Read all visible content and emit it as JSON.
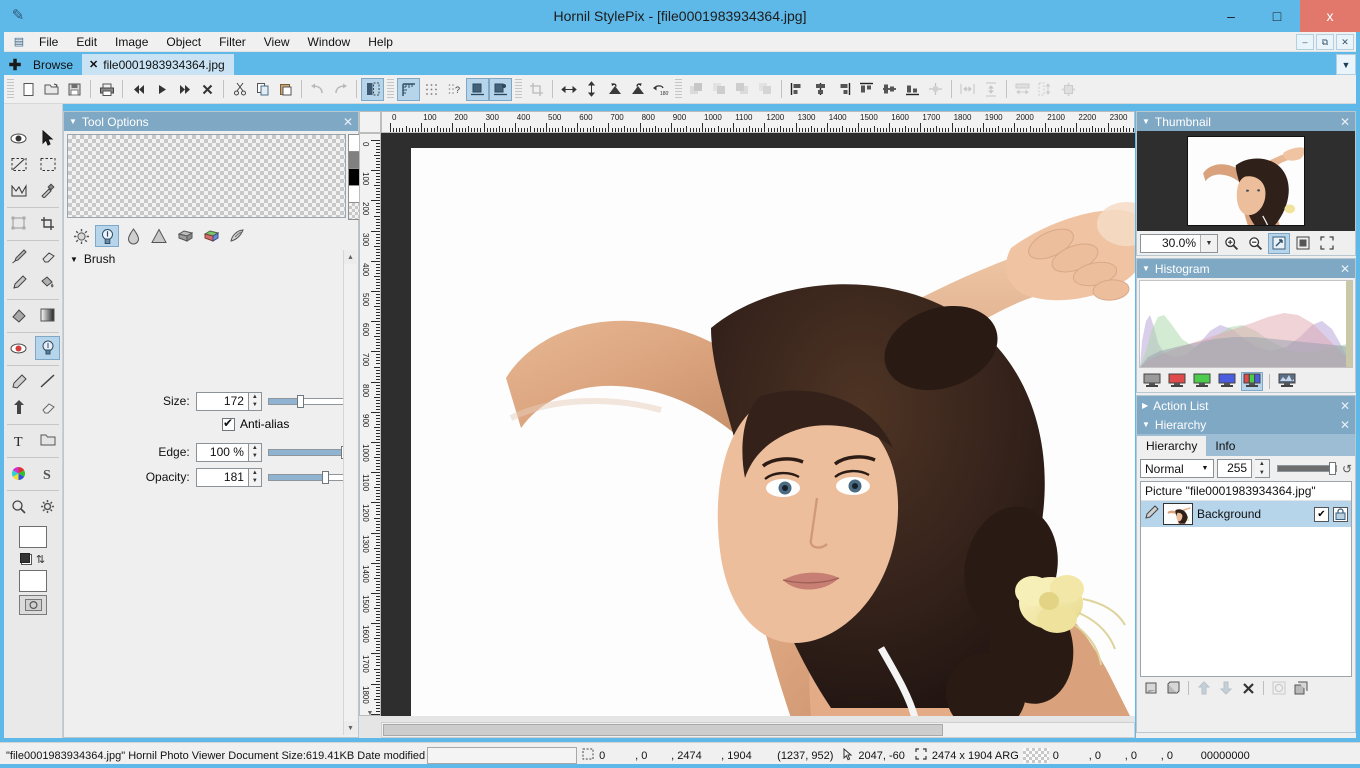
{
  "window": {
    "title": "Hornil StylePix - [file0001983934364.jpg]",
    "app_icon": "pencil-icon",
    "minimize": "–",
    "maximize": "□",
    "close": "x"
  },
  "menubar": {
    "logo": "stylepix-logo-icon",
    "items": [
      "File",
      "Edit",
      "Image",
      "Object",
      "Filter",
      "View",
      "Window",
      "Help"
    ],
    "mdi_buttons": [
      "–",
      "⧉",
      "✕"
    ]
  },
  "tabbar": {
    "add_label": "✚",
    "tabs": [
      {
        "label": "Browse",
        "closable": false,
        "active": false
      },
      {
        "label": "file0001983934364.jpg",
        "closable": true,
        "close_glyph": "✕",
        "active": true
      }
    ],
    "overflow_glyph": "▼"
  },
  "toolbar": {
    "groups": [
      {
        "buttons": [
          {
            "name": "new-document-button",
            "glyph": "▯",
            "state": "normal"
          },
          {
            "name": "open-file-button",
            "glyph": "📂",
            "state": "normal"
          },
          {
            "name": "save-file-button",
            "glyph": "💾",
            "state": "normal"
          }
        ]
      },
      {
        "buttons": [
          {
            "name": "print-button",
            "glyph": "🖨",
            "state": "normal"
          }
        ]
      },
      {
        "buttons": [
          {
            "name": "previous-frame-button",
            "glyph": "◀◀",
            "state": "normal"
          },
          {
            "name": "play-button",
            "glyph": "▶",
            "state": "normal"
          },
          {
            "name": "next-frame-button",
            "glyph": "▶▶",
            "state": "normal"
          },
          {
            "name": "stop-button",
            "glyph": "✕",
            "state": "normal"
          }
        ]
      },
      {
        "buttons": [
          {
            "name": "cut-button",
            "glyph": "✂",
            "state": "normal"
          },
          {
            "name": "copy-button",
            "glyph": "⧉",
            "state": "normal"
          },
          {
            "name": "paste-button",
            "glyph": "📋",
            "state": "normal"
          }
        ]
      },
      {
        "buttons": [
          {
            "name": "undo-button",
            "glyph": "↩",
            "state": "disabled"
          },
          {
            "name": "redo-button",
            "glyph": "↪",
            "state": "disabled"
          }
        ]
      },
      {
        "buttons": [
          {
            "name": "toggle-panel-button",
            "glyph": "▮",
            "state": "active"
          }
        ]
      },
      {
        "buttons": [
          {
            "name": "show-rulers-button",
            "glyph": "ruler-icon",
            "state": "active"
          },
          {
            "name": "show-grid-button",
            "glyph": "grid-icon",
            "state": "normal"
          },
          {
            "name": "show-guides-button",
            "glyph": "guides-icon",
            "state": "normal"
          },
          {
            "name": "snap-to-canvas-button",
            "glyph": "snap-canvas-icon",
            "state": "active"
          },
          {
            "name": "snap-to-guides-button",
            "glyph": "snap-guides-icon",
            "state": "active"
          }
        ]
      },
      {
        "buttons": [
          {
            "name": "crop-button",
            "glyph": "crop-icon",
            "state": "disabled"
          }
        ]
      },
      {
        "buttons": [
          {
            "name": "flip-horizontal-button",
            "glyph": "↔",
            "state": "normal"
          },
          {
            "name": "flip-vertical-button",
            "glyph": "↕",
            "state": "normal"
          },
          {
            "name": "rotate-left-button",
            "glyph": "rotate-ccw-icon",
            "state": "normal"
          },
          {
            "name": "rotate-right-button",
            "glyph": "rotate-cw-icon",
            "state": "normal"
          },
          {
            "name": "rotate-180-button",
            "glyph": "rotate-180-icon",
            "state": "normal"
          }
        ]
      },
      {
        "buttons": [
          {
            "name": "arrange-bring-front-button",
            "glyph": "▰",
            "state": "disabled"
          },
          {
            "name": "arrange-bring-forward-button",
            "glyph": "▱",
            "state": "disabled"
          },
          {
            "name": "arrange-send-backward-button",
            "glyph": "▰",
            "state": "disabled"
          },
          {
            "name": "arrange-send-back-button",
            "glyph": "▱",
            "state": "disabled"
          }
        ]
      },
      {
        "buttons": [
          {
            "name": "align-left-button",
            "glyph": "align-left-icon",
            "state": "normal"
          },
          {
            "name": "align-center-horizontal-button",
            "glyph": "align-center-h-icon",
            "state": "normal"
          },
          {
            "name": "align-right-button",
            "glyph": "align-right-icon",
            "state": "normal"
          },
          {
            "name": "align-top-button",
            "glyph": "align-top-icon",
            "state": "normal"
          },
          {
            "name": "align-middle-button",
            "glyph": "align-middle-icon",
            "state": "normal"
          },
          {
            "name": "align-bottom-button",
            "glyph": "align-bottom-icon",
            "state": "normal"
          },
          {
            "name": "align-center-button",
            "glyph": "align-center-icon",
            "state": "disabled"
          }
        ]
      },
      {
        "buttons": [
          {
            "name": "distribute-horizontal-button",
            "glyph": "dist-h-icon",
            "state": "disabled"
          },
          {
            "name": "distribute-vertical-button",
            "glyph": "dist-v-icon",
            "state": "disabled"
          }
        ]
      },
      {
        "buttons": [
          {
            "name": "match-width-button",
            "glyph": "match-w-icon",
            "state": "disabled"
          },
          {
            "name": "match-height-button",
            "glyph": "match-h-icon",
            "state": "disabled"
          },
          {
            "name": "match-size-button",
            "glyph": "match-size-icon",
            "state": "disabled"
          }
        ]
      }
    ]
  },
  "tool_palette": {
    "tools": [
      {
        "name": "visibility-tool",
        "glyph": "👁",
        "active": false
      },
      {
        "name": "move-tool",
        "glyph": "➤",
        "active": false
      },
      {
        "name": "lasso-select-tool",
        "glyph": "lasso-icon",
        "active": false
      },
      {
        "name": "rectangle-select-tool",
        "glyph": "marquee-icon",
        "active": false
      },
      {
        "name": "polygon-select-tool",
        "glyph": "polygon-icon",
        "active": false
      },
      {
        "name": "eyedropper-tool",
        "glyph": "eyedropper-icon",
        "active": false
      },
      {
        "name": "transform-tool",
        "glyph": "transform-icon",
        "active": false
      },
      {
        "name": "crop-tool",
        "glyph": "crop-icon",
        "active": false
      },
      {
        "name": "paintbrush-tool",
        "glyph": "brush-icon",
        "active": false
      },
      {
        "name": "eraser-tool",
        "glyph": "eraser-icon",
        "active": false
      },
      {
        "name": "pencil-tool",
        "glyph": "pencil-icon",
        "active": false
      },
      {
        "name": "paint-bucket-tool",
        "glyph": "bucket-icon",
        "active": false
      },
      {
        "name": "fill-tool",
        "glyph": "fill-icon",
        "active": false
      },
      {
        "name": "gradient-tool",
        "glyph": "gradient-icon",
        "active": false
      },
      {
        "name": "red-eye-tool",
        "glyph": "red-eye-icon",
        "active": false
      },
      {
        "name": "dodge-burn-tool",
        "glyph": "bulb-icon",
        "active": true
      },
      {
        "name": "pen-tool",
        "glyph": "pen-icon",
        "active": false
      },
      {
        "name": "line-tool",
        "glyph": "line-icon",
        "active": false
      },
      {
        "name": "path-arrow-tool",
        "glyph": "arrow-up-icon",
        "active": false
      },
      {
        "name": "clone-stamp-tool",
        "glyph": "clone-icon",
        "active": false
      },
      {
        "name": "text-tool",
        "glyph": "T",
        "active": false
      },
      {
        "name": "shape-folder-tool",
        "glyph": "folder-icon",
        "active": false
      },
      {
        "name": "color-picker-tool",
        "glyph": "color-wheel-icon",
        "active": false
      },
      {
        "name": "style-tool",
        "glyph": "S",
        "active": false
      },
      {
        "name": "zoom-tool",
        "glyph": "🔍",
        "active": false
      },
      {
        "name": "settings-tool",
        "glyph": "gear-icon",
        "active": false
      }
    ],
    "foreground_color": "#ffffff",
    "background_color": "#ffffff",
    "quickmask_glyph": "quickmask-icon"
  },
  "tool_options": {
    "panel_title": "Tool Options",
    "collapse_glyph": "▼",
    "close_glyph": "✕",
    "swatches": [
      "#ffffff",
      "#808080",
      "#000000",
      "#ffffff",
      "checker"
    ],
    "brush_modes": [
      {
        "name": "dodge-mode-icon",
        "glyph": "☀",
        "active": false
      },
      {
        "name": "burn-mode-icon",
        "glyph": "💡",
        "active": true
      },
      {
        "name": "blur-mode-icon",
        "glyph": "💧",
        "active": false
      },
      {
        "name": "sharpen-mode-icon",
        "glyph": "▲",
        "active": false
      },
      {
        "name": "sponge-mode-icon",
        "glyph": "sponge-icon",
        "active": false
      },
      {
        "name": "saturation-mode-icon",
        "glyph": "color-sponge-icon",
        "active": false
      },
      {
        "name": "smudge-mode-icon",
        "glyph": "smudge-icon",
        "active": false
      }
    ],
    "section": {
      "title": "Brush",
      "collapse_glyph": "▼"
    },
    "fields": [
      {
        "name": "brush-size",
        "label": "Size:",
        "accel": "S",
        "value": "172",
        "slider_pct": 38,
        "reset_glyph": "↺"
      },
      {
        "name": "brush-edge",
        "label": "Edge:",
        "accel": "E",
        "value": "100 %",
        "slider_pct": 98,
        "reset_glyph": "↺"
      },
      {
        "name": "brush-opacity",
        "label": "Opacity:",
        "accel": "O",
        "value": "181",
        "slider_pct": 71,
        "reset_glyph": "↺"
      }
    ],
    "antialias": {
      "label": "Anti-alias",
      "checked": true
    }
  },
  "canvas": {
    "h_ruler": {
      "min": 0,
      "max": 2400,
      "step": 100,
      "unit": "px"
    },
    "v_ruler": {
      "min": 0,
      "max": 1900,
      "step": 100,
      "unit": "px"
    },
    "background": "#2e2e2e"
  },
  "thumbnail_panel": {
    "title": "Thumbnail",
    "collapse_glyph": "▼",
    "close_glyph": "✕",
    "zoom_value": "30.0%",
    "dropdown_glyph": "▼",
    "buttons": [
      {
        "name": "zoom-in-button",
        "glyph": "🔍",
        "sign": "+",
        "active": false
      },
      {
        "name": "zoom-out-button",
        "glyph": "🔍",
        "sign": "−",
        "active": false
      },
      {
        "name": "fit-to-window-button",
        "glyph": "⤢",
        "active": true
      },
      {
        "name": "actual-size-button",
        "glyph": "▣",
        "active": false
      },
      {
        "name": "fullscreen-button",
        "glyph": "⛶",
        "active": false
      }
    ]
  },
  "histogram_panel": {
    "title": "Histogram",
    "collapse_glyph": "▼",
    "close_glyph": "✕",
    "channels": [
      {
        "name": "channel-gray-button",
        "color": "#9a9a9a",
        "active": false
      },
      {
        "name": "channel-red-button",
        "color": "#e04a4a",
        "active": false
      },
      {
        "name": "channel-green-button",
        "color": "#4ccb4c",
        "active": false
      },
      {
        "name": "channel-blue-button",
        "color": "#4a5ce0",
        "active": false
      },
      {
        "name": "channel-rgb-button",
        "color": "rgb",
        "active": true
      },
      {
        "name": "channel-all-button",
        "color": "all",
        "active": false
      }
    ]
  },
  "action_list_panel": {
    "title": "Action List",
    "collapse_glyph": "▶",
    "close_glyph": "✕"
  },
  "hierarchy_panel": {
    "title": "Hierarchy",
    "collapse_glyph": "▼",
    "close_glyph": "✕",
    "tabs": [
      {
        "label": "Hierarchy",
        "active": true
      },
      {
        "label": "Info",
        "active": false
      }
    ],
    "blend_mode": "Normal",
    "blend_dropdown_glyph": "▼",
    "opacity_value": "255",
    "opacity_slider_pct": 100,
    "reset_glyph": "↺",
    "root_label": "Picture \"file0001983934364.jpg\"",
    "layers": [
      {
        "name": "Background",
        "visible_glyph": "✔",
        "lock_glyph": "🔒",
        "selected": true
      }
    ],
    "footer_buttons": [
      {
        "name": "new-layer-button",
        "glyph": "▱",
        "state": "normal"
      },
      {
        "name": "duplicate-layer-button",
        "glyph": "▰",
        "state": "normal"
      },
      {
        "name": "move-layer-up-button",
        "glyph": "⬆",
        "state": "disabled"
      },
      {
        "name": "move-layer-down-button",
        "glyph": "⬇",
        "state": "disabled"
      },
      {
        "name": "delete-layer-button",
        "glyph": "✕",
        "state": "normal"
      },
      {
        "name": "layer-mask-button",
        "glyph": "◯",
        "state": "disabled"
      },
      {
        "name": "merge-layers-button",
        "glyph": "▰",
        "state": "normal"
      }
    ]
  },
  "statusbar": {
    "document_info": "\"file0001983934364.jpg\" Hornil Photo Viewer Document Size:619.41KB Date modified",
    "date_field_value": "",
    "selection_icon": "selection-icon",
    "selection_x": "0",
    "selection_y": ", 0",
    "selection_w": ", 2474",
    "selection_h": ", 1904",
    "selection_center": "(1237, 952)",
    "cursor_icon": "cursor-icon",
    "cursor_pos": "2047, -60",
    "size_icon": "resize-icon",
    "image_size": "2474 x 1904 ARG",
    "color_icon": "transparency-icon",
    "color_a": "0",
    "color_r": ", 0",
    "color_g": ", 0",
    "color_b": ", 0",
    "color_hex": "00000000"
  },
  "colors": {
    "titlebar": "#5eb8e8",
    "panel_header": "#7fa8c4",
    "accent_selected": "#b6d4ea",
    "close_button": "#e2786c",
    "canvas_bg": "#2e2e2e",
    "tab_active": "#c9e3f4"
  }
}
